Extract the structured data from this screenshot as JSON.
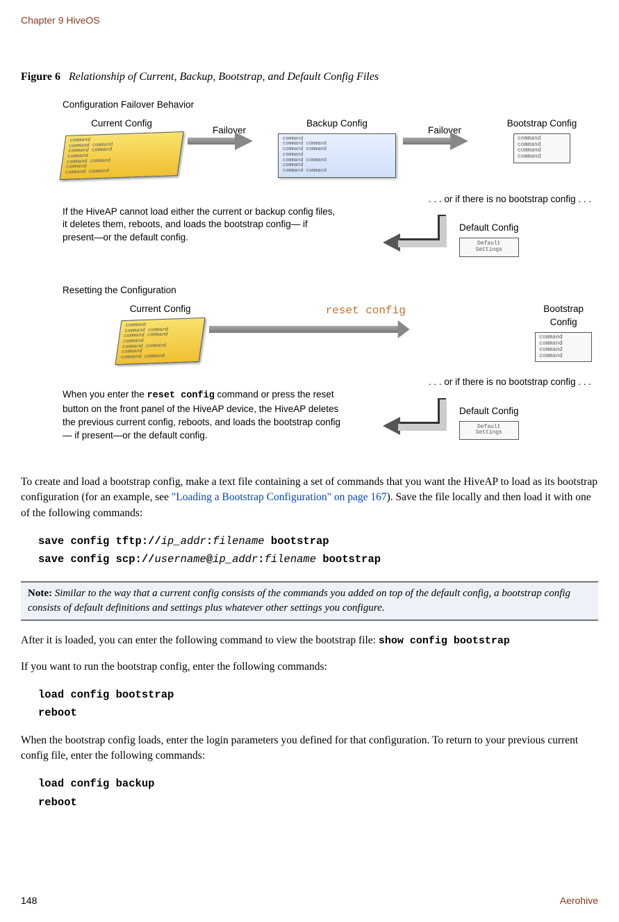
{
  "header": {
    "chapter": "Chapter 9 HiveOS"
  },
  "figure": {
    "number": "Figure 6",
    "title": "Relationship of Current, Backup, Bootstrap, and Default Config Files"
  },
  "diagram": {
    "section1_title": "Configuration Failover Behavior",
    "labels": {
      "current": "Current Config",
      "backup": "Backup Config",
      "bootstrap": "Bootstrap Config",
      "default": "Default Config",
      "failover": "Failover",
      "orif": ". . . or if there is no bootstrap config . . .",
      "reset_cmd": "reset config",
      "default_settings": "Default\nSettings"
    },
    "box_text_1": "command\ncommand command\ncommand command\ncommand\ncommand command\ncommand\ncommand command",
    "box_text_2": "command\ncommand command\ncommand command\ncommand\ncommand command\ncommand\ncommand command",
    "box_text_small": "command\ncommand\ncommand\ncommand",
    "explain1": "If the HiveAP cannot load either the current or backup config files, it deletes them, reboots, and loads the bootstrap config— if present—or the default config.",
    "section2_title": "Resetting the Configuration",
    "explain2_pre": "When you enter the ",
    "explain2_cmd": "reset config",
    "explain2_post": " command or press the reset button on the front panel of the HiveAP device, the HiveAP deletes the previous current config, reboots, and loads the bootstrap config— if present—or the default config."
  },
  "body": {
    "para1_a": "To create and load a bootstrap config, make a text file containing a set of commands that you want the HiveAP to load as its bootstrap configuration (for an example, see ",
    "para1_link": "\"Loading a Bootstrap Configuration\" on page 167",
    "para1_b": "). Save the file locally and then load it with one of the following commands:",
    "cmd1_a": "save config tftp://",
    "cmd1_var1": "ip_addr",
    "cmd1_b": ":",
    "cmd1_var2": "filename",
    "cmd1_c": " bootstrap",
    "cmd2_a": "save config scp://",
    "cmd2_var1": "username",
    "cmd2_b": "@",
    "cmd2_var2": "ip_addr",
    "cmd2_c": ":",
    "cmd2_var3": "filename",
    "cmd2_d": " bootstrap",
    "note_label": "Note:",
    "note_text": " Similar to the way that a current config consists of the commands you added on top of the default config, a bootstrap config consists of default definitions and settings plus whatever other settings you configure.",
    "para2_a": "After it is loaded, you can enter the following command to view the bootstrap file: ",
    "para2_cmd": "show config bootstrap",
    "para3": "If you want to run the bootstrap config, enter the following commands:",
    "cmd3": "load config bootstrap",
    "cmd4": "reboot",
    "para4": "When the bootstrap config loads, enter the login parameters you defined for that configuration. To return to your previous current config file, enter the following commands:",
    "cmd5": "load config backup",
    "cmd6": "reboot"
  },
  "footer": {
    "page": "148",
    "brand": "Aerohive"
  }
}
